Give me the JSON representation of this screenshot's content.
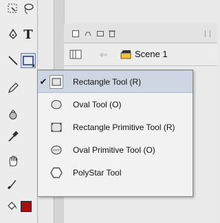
{
  "tools_panel": {
    "tools": [
      {
        "icon": "free-transform-icon"
      },
      {
        "icon": "lasso-icon"
      },
      {
        "icon": "pen-icon"
      },
      {
        "icon": "text-icon",
        "label": "T"
      },
      {
        "icon": "line-icon"
      },
      {
        "icon": "rectangle-icon",
        "pressed": true
      },
      {
        "icon": "pencil-icon"
      },
      {
        "icon": "ink-bottle-icon"
      },
      {
        "icon": "eyedropper-icon"
      },
      {
        "icon": "hand-icon"
      },
      {
        "icon": "brush-icon"
      },
      {
        "icon": "paint-bucket-icon"
      }
    ],
    "fill_color": "#aa0d0d"
  },
  "timeline": {
    "icons": [
      "eye-icon",
      "lock-icon",
      "outline-icon",
      "trash-icon"
    ]
  },
  "scene_bar": {
    "scene_label": "Scene 1"
  },
  "shape_menu": {
    "items": [
      {
        "label": "Rectangle Tool (R)",
        "icon": "rectangle-icon",
        "checked": true
      },
      {
        "label": "Oval Tool (O)",
        "icon": "oval-icon",
        "checked": false
      },
      {
        "label": "Rectangle Primitive Tool (R)",
        "icon": "rectangle-primitive-icon",
        "checked": false
      },
      {
        "label": "Oval Primitive Tool (O)",
        "icon": "oval-primitive-icon",
        "checked": false
      },
      {
        "label": "PolyStar Tool",
        "icon": "polystar-icon",
        "checked": false
      }
    ],
    "check_glyph": "✔"
  }
}
